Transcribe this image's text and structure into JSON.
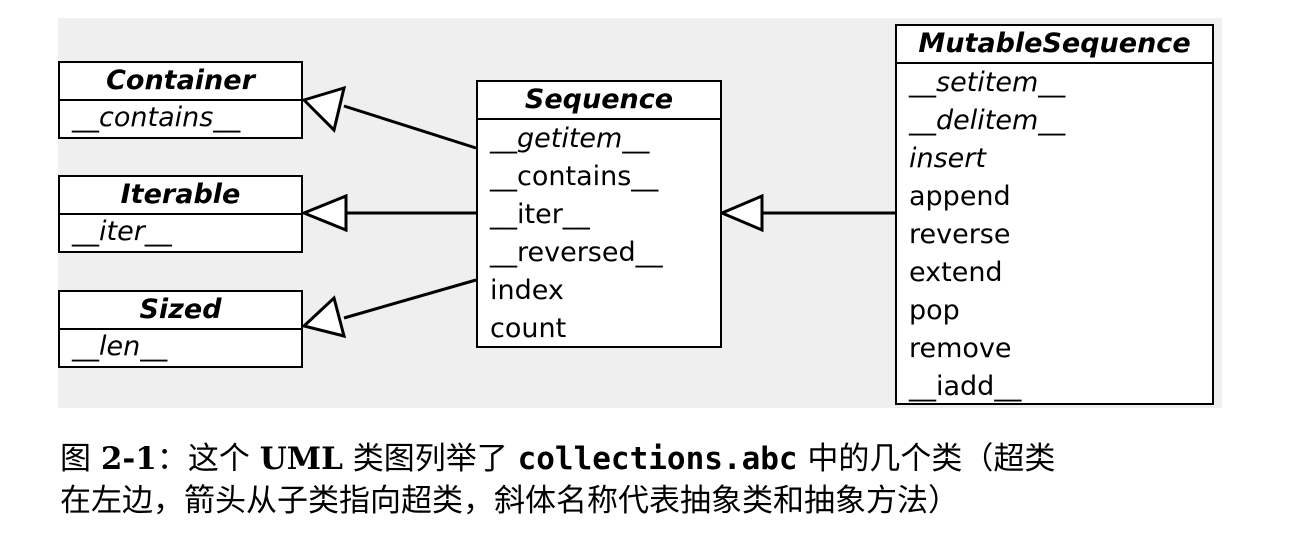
{
  "boxes": {
    "container": {
      "title": "Container",
      "members": [
        "__contains__"
      ]
    },
    "iterable": {
      "title": "Iterable",
      "members": [
        "__iter__"
      ]
    },
    "sized": {
      "title": "Sized",
      "members": [
        "__len__"
      ]
    },
    "sequence": {
      "title": "Sequence",
      "members": [
        "__getitem__",
        "__contains__",
        "__iter__",
        "__reversed__",
        "index",
        "count"
      ]
    },
    "mutable_sequence": {
      "title": "MutableSequence",
      "members": [
        "__setitem__",
        "__delitem__",
        "insert",
        "append",
        "reverse",
        "extend",
        "pop",
        "remove",
        "__iadd__"
      ]
    }
  },
  "caption": {
    "prefix": "图 ",
    "figure_number": "2-1",
    "colon_text": "：这个 ",
    "uml": "UML",
    "middle": " 类图列举了 ",
    "module": "collections.abc",
    "line1_rest": " 中的几个类（超类",
    "line2": "在左边，箭头从子类指向超类，斜体名称代表抽象类和抽象方法）"
  }
}
